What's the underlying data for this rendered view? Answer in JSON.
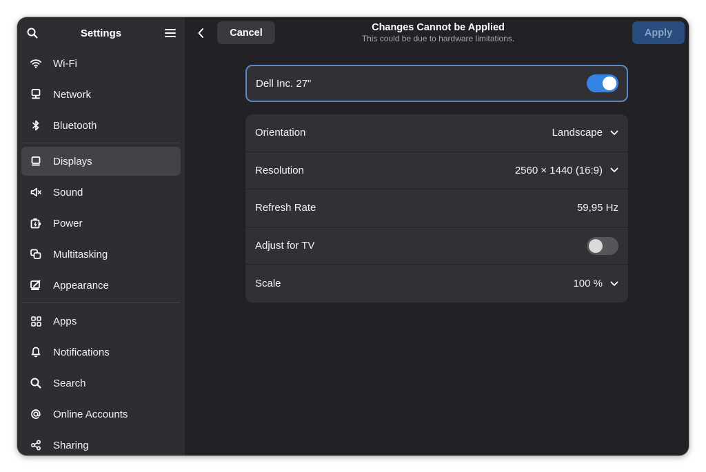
{
  "sidebar": {
    "title": "Settings",
    "groups": [
      [
        {
          "label": "Wi-Fi",
          "icon": "wifi-icon"
        },
        {
          "label": "Network",
          "icon": "network-icon"
        },
        {
          "label": "Bluetooth",
          "icon": "bluetooth-icon"
        }
      ],
      [
        {
          "label": "Displays",
          "icon": "display-icon",
          "active": true
        },
        {
          "label": "Sound",
          "icon": "speaker-icon"
        },
        {
          "label": "Power",
          "icon": "power-icon"
        },
        {
          "label": "Multitasking",
          "icon": "multitasking-icon"
        },
        {
          "label": "Appearance",
          "icon": "appearance-icon"
        }
      ],
      [
        {
          "label": "Apps",
          "icon": "apps-grid-icon"
        },
        {
          "label": "Notifications",
          "icon": "bell-icon"
        },
        {
          "label": "Search",
          "icon": "search-icon"
        },
        {
          "label": "Online Accounts",
          "icon": "at-sign-icon"
        },
        {
          "label": "Sharing",
          "icon": "share-icon"
        }
      ]
    ]
  },
  "header": {
    "cancel_label": "Cancel",
    "title": "Changes Cannot be Applied",
    "subtitle": "This could be due to hardware limitations.",
    "apply_label": "Apply"
  },
  "monitor": {
    "name": "Dell Inc. 27\"",
    "enabled": true
  },
  "settings": {
    "orientation": {
      "label": "Orientation",
      "value": "Landscape"
    },
    "resolution": {
      "label": "Resolution",
      "value": "2560 × 1440 (16:9)"
    },
    "refresh_rate": {
      "label": "Refresh Rate",
      "value": "59,95 Hz"
    },
    "adjust_tv": {
      "label": "Adjust for TV",
      "enabled": false
    },
    "scale": {
      "label": "Scale",
      "value": "100 %"
    }
  },
  "colors": {
    "accent": "#3584e4",
    "window_bg": "#222226",
    "sidebar_bg": "#2e2e32",
    "card_bg": "#313135",
    "apply_bg": "#284c7d"
  }
}
